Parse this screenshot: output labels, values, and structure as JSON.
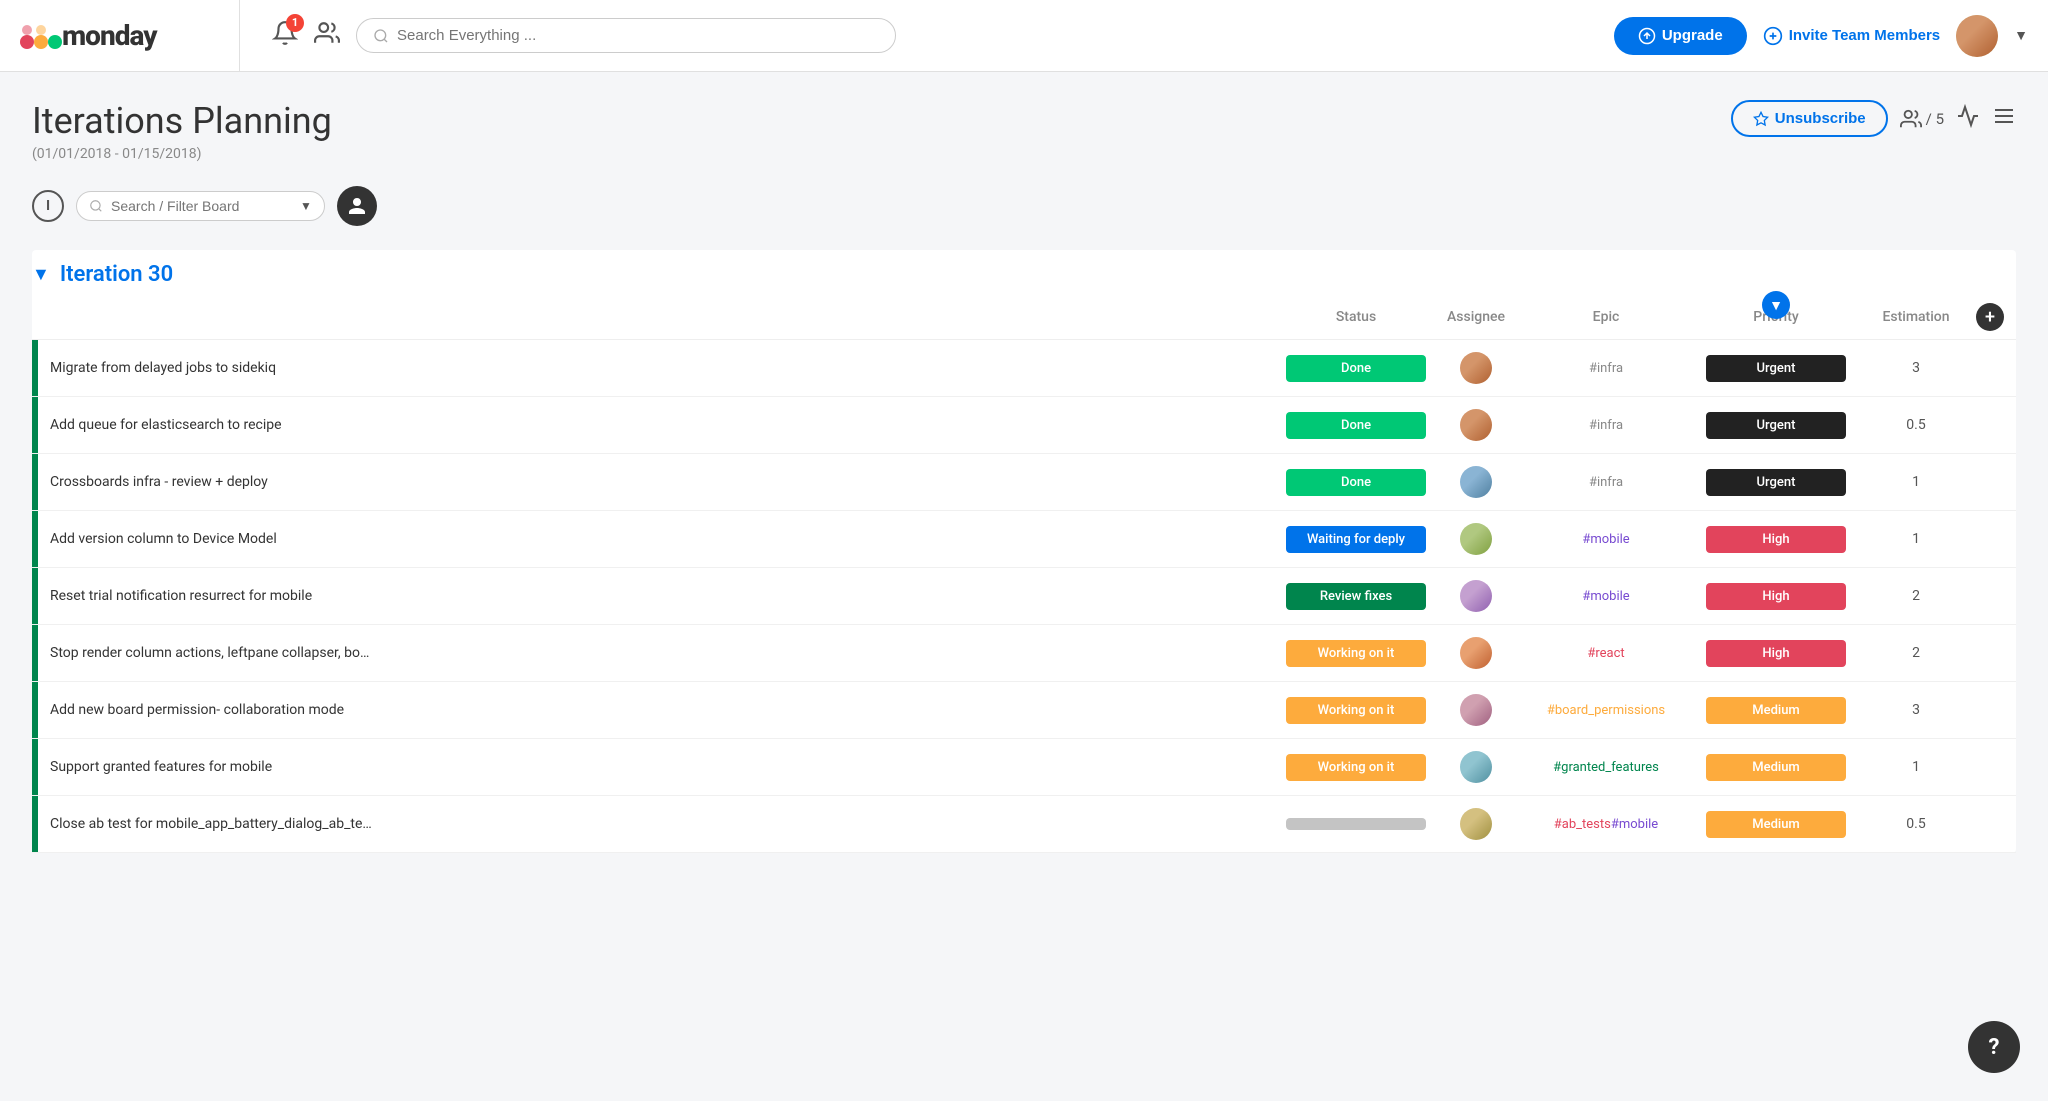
{
  "app": {
    "logo": "monday",
    "logo_dots": [
      "red",
      "orange",
      "green"
    ]
  },
  "topnav": {
    "search_placeholder": "Search Everything ...",
    "upgrade_label": "Upgrade",
    "invite_label": "Invite Team Members",
    "notification_count": "1"
  },
  "page": {
    "title": "Iterations Planning",
    "subtitle": "(01/01/2018 - 01/15/2018)",
    "unsubscribe_label": "Unsubscribe",
    "members_count": "/ 5"
  },
  "filter": {
    "info_label": "I",
    "placeholder": "Search / Filter Board"
  },
  "iteration": {
    "title": "Iteration 30",
    "columns": {
      "task": "",
      "status": "Status",
      "assignee": "Assignee",
      "epic": "Epic",
      "priority": "Priority",
      "estimation": "Estimation"
    },
    "rows": [
      {
        "task": "Migrate from delayed jobs to sidekiq",
        "status": "Done",
        "status_class": "status-done",
        "assignee_class": "av1",
        "epic": "#infra",
        "epic_class": "epic-grey",
        "priority": "Urgent",
        "priority_class": "priority-urgent",
        "estimation": "3"
      },
      {
        "task": "Add queue for elasticsearch to recipe",
        "status": "Done",
        "status_class": "status-done",
        "assignee_class": "av1",
        "epic": "#infra",
        "epic_class": "epic-grey",
        "priority": "Urgent",
        "priority_class": "priority-urgent",
        "estimation": "0.5"
      },
      {
        "task": "Crossboards infra - review + deploy",
        "status": "Done",
        "status_class": "status-done",
        "assignee_class": "av2",
        "epic": "#infra",
        "epic_class": "epic-grey",
        "priority": "Urgent",
        "priority_class": "priority-urgent",
        "estimation": "1"
      },
      {
        "task": "Add version column to Device Model",
        "status": "Waiting for deply",
        "status_class": "status-waiting",
        "assignee_class": "av3",
        "epic": "#mobile",
        "epic_class": "epic-purple",
        "priority": "High",
        "priority_class": "priority-high",
        "estimation": "1"
      },
      {
        "task": "Reset trial notification resurrect for mobile",
        "status": "Review fixes",
        "status_class": "status-review",
        "assignee_class": "av4",
        "epic": "#mobile",
        "epic_class": "epic-purple",
        "priority": "High",
        "priority_class": "priority-high",
        "estimation": "2"
      },
      {
        "task": "Stop render column actions, leftpane collapser, bo…",
        "status": "Working on it",
        "status_class": "status-working",
        "assignee_class": "av5",
        "epic": "#react",
        "epic_class": "epic-red",
        "priority": "High",
        "priority_class": "priority-high",
        "estimation": "2"
      },
      {
        "task": "Add new board permission- collaboration mode",
        "status": "Working on it",
        "status_class": "status-working",
        "assignee_class": "av6",
        "epic": "#board_permissions",
        "epic_class": "epic-orange",
        "priority": "Medium",
        "priority_class": "priority-medium",
        "estimation": "3"
      },
      {
        "task": "Support granted features for mobile",
        "status": "Working on it",
        "status_class": "status-working",
        "assignee_class": "av7",
        "epic": "#granted_features",
        "epic_class": "epic-green",
        "priority": "Medium",
        "priority_class": "priority-medium",
        "estimation": "1"
      },
      {
        "task": "Close ab test for mobile_app_battery_dialog_ab_te…",
        "status": "",
        "status_class": "status-empty",
        "assignee_class": "av8",
        "epic": "#ab_tests #mobile",
        "epic_class": "epic-red",
        "priority": "Medium",
        "priority_class": "priority-medium",
        "estimation": "0.5"
      }
    ]
  },
  "help": {
    "label": "?"
  }
}
